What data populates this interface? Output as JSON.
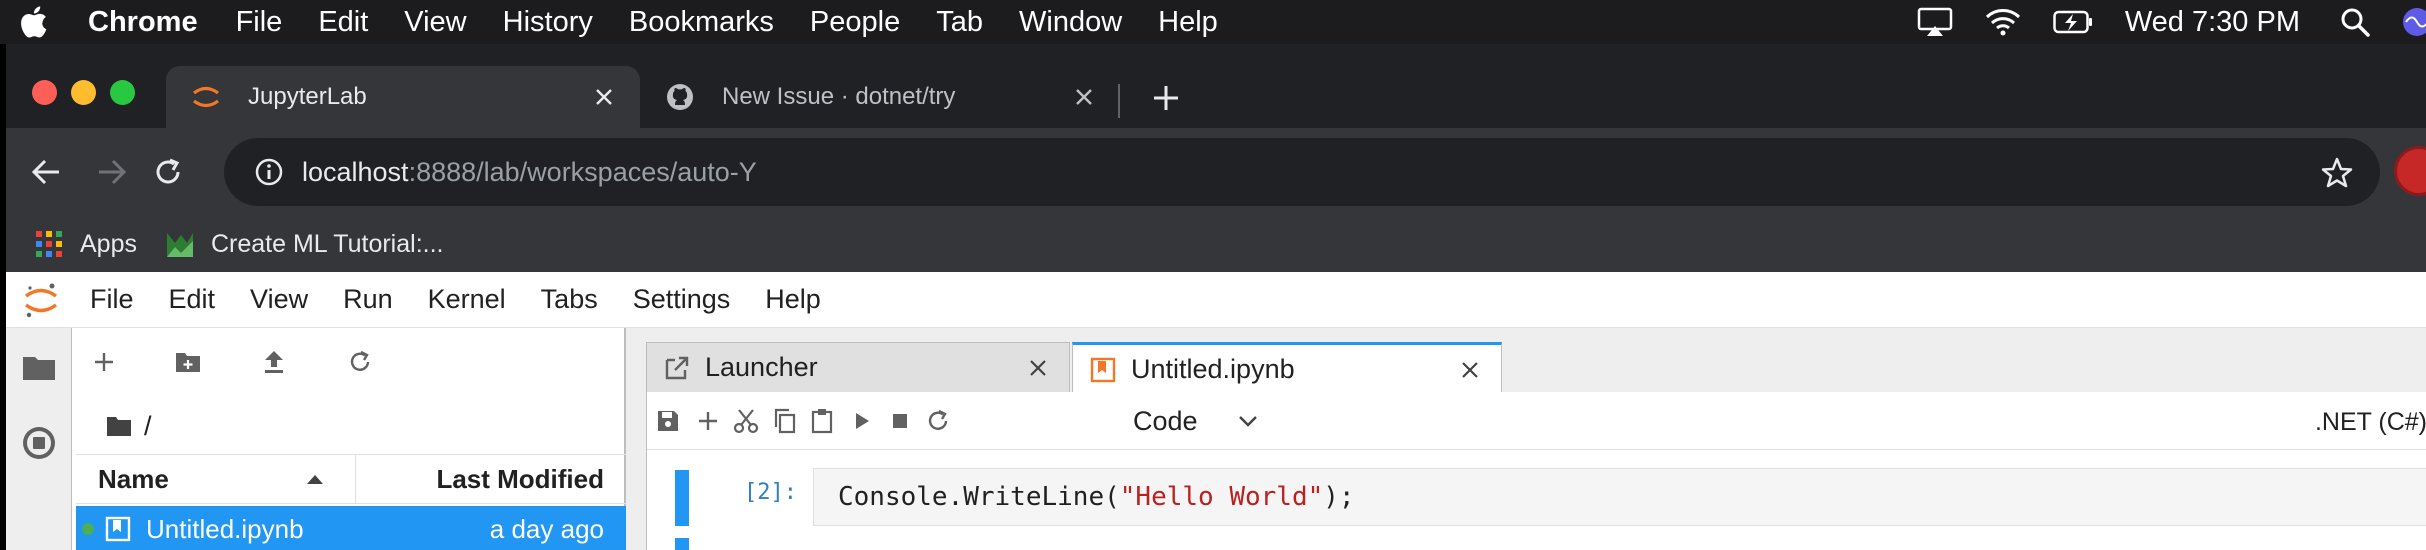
{
  "mac_menubar": {
    "app_name": "Chrome",
    "menus": [
      "File",
      "Edit",
      "View",
      "History",
      "Bookmarks",
      "People",
      "Tab",
      "Window",
      "Help"
    ],
    "clock": "Wed 7:30 PM"
  },
  "browser": {
    "tabs": [
      {
        "title": "JupyterLab",
        "active": true,
        "icon": "jupyter-logo-icon"
      },
      {
        "title": "New Issue · dotnet/try",
        "active": false,
        "icon": "github-icon"
      }
    ],
    "url_host": "localhost",
    "url_path": ":8888/lab/workspaces/auto-Y",
    "bookmarks": [
      {
        "label": "Apps",
        "icon": "apps-grid-icon"
      },
      {
        "label": "Create ML Tutorial:...",
        "icon": "createml-icon"
      }
    ]
  },
  "jupyter": {
    "menus": [
      "File",
      "Edit",
      "View",
      "Run",
      "Kernel",
      "Tabs",
      "Settings",
      "Help"
    ],
    "filebrowser": {
      "breadcrumb": "/",
      "col_name": "Name",
      "col_modified": "Last Modified",
      "files": [
        {
          "name": "Untitled.ipynb",
          "modified": "a day ago",
          "running": true
        }
      ]
    },
    "doc_tabs": [
      {
        "title": "Launcher"
      },
      {
        "title": "Untitled.ipynb"
      }
    ],
    "notebook": {
      "cell_type": "Code",
      "kernel": ".NET (C#)",
      "cells": [
        {
          "prompt": "[2]:",
          "code_prefix": "Console.WriteLine(",
          "code_string": "\"Hello World\"",
          "code_suffix": ");"
        }
      ]
    }
  },
  "colors": {
    "jupyter_orange": "#f37726",
    "selection_blue": "#2196f3",
    "chrome_dark": "#202124"
  }
}
